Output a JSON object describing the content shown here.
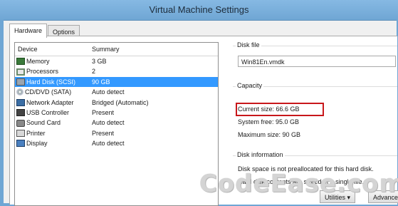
{
  "window": {
    "title": "Virtual Machine Settings"
  },
  "tabs": [
    {
      "label": "Hardware"
    },
    {
      "label": "Options"
    }
  ],
  "devices": {
    "header": {
      "device": "Device",
      "summary": "Summary"
    },
    "rows": [
      {
        "icon": "memory-icon",
        "device": "Memory",
        "summary": "3 GB"
      },
      {
        "icon": "processor-icon",
        "device": "Processors",
        "summary": "2"
      },
      {
        "icon": "hard-disk-icon",
        "device": "Hard Disk (SCSI)",
        "summary": "90 GB"
      },
      {
        "icon": "cd-dvd-icon",
        "device": "CD/DVD (SATA)",
        "summary": "Auto detect"
      },
      {
        "icon": "network-adapter-icon",
        "device": "Network Adapter",
        "summary": "Bridged (Automatic)"
      },
      {
        "icon": "usb-icon",
        "device": "USB Controller",
        "summary": "Present"
      },
      {
        "icon": "sound-card-icon",
        "device": "Sound Card",
        "summary": "Auto detect"
      },
      {
        "icon": "printer-icon",
        "device": "Printer",
        "summary": "Present"
      },
      {
        "icon": "display-icon",
        "device": "Display",
        "summary": "Auto detect"
      }
    ]
  },
  "disk_file": {
    "label": "Disk file",
    "value": "Win81En.vmdk"
  },
  "capacity": {
    "label": "Capacity",
    "current_size": "Current size: 66.6 GB",
    "system_free": "System free: 95.0 GB",
    "maximum_size": "Maximum size: 90 GB"
  },
  "disk_information": {
    "label": "Disk information",
    "line1": "Disk space is not preallocated for this hard disk.",
    "line2": "Hard disk contents are stored in a single file."
  },
  "buttons": {
    "utilities": "Utilities",
    "advanced": "Advanced"
  },
  "watermark": "CodeEase.com"
}
